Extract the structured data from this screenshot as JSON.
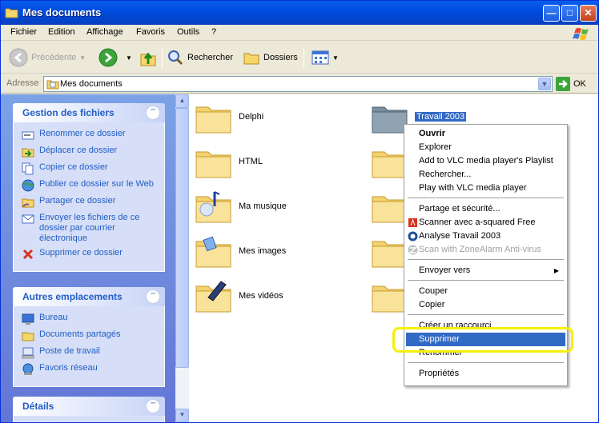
{
  "window": {
    "title": "Mes documents"
  },
  "menu": [
    "Fichier",
    "Edition",
    "Affichage",
    "Favoris",
    "Outils",
    "?"
  ],
  "toolbar": {
    "back_label": "Précédente",
    "search_label": "Rechercher",
    "folders_label": "Dossiers"
  },
  "address": {
    "label": "Adresse",
    "value": "Mes documents",
    "go_label": "OK"
  },
  "file_tasks": {
    "title": "Gestion des fichiers",
    "items": [
      "Renommer ce dossier",
      "Déplacer ce dossier",
      "Copier ce dossier",
      "Publier ce dossier sur le Web",
      "Partager ce dossier",
      "Envoyer les fichiers de ce dossier par courrier électronique",
      "Supprimer ce dossier"
    ]
  },
  "other_places": {
    "title": "Autres emplacements",
    "items": [
      "Bureau",
      "Documents partagés",
      "Poste de travail",
      "Favoris réseau"
    ]
  },
  "details": {
    "title": "Détails"
  },
  "folders": [
    {
      "name": "Delphi"
    },
    {
      "name": "HTML"
    },
    {
      "name": "Ma musique"
    },
    {
      "name": "Mes images"
    },
    {
      "name": "Mes vidéos"
    },
    {
      "name": "Travail 2003"
    }
  ],
  "context_menu": [
    "Ouvrir",
    "Explorer",
    "Add to VLC media player's Playlist",
    "Rechercher...",
    "Play with VLC media player",
    "Partage et sécurité...",
    "Scanner avec a-squared Free",
    "Analyse Travail 2003",
    "Scan with ZoneAlarm Anti-virus",
    "Envoyer vers",
    "Couper",
    "Copier",
    "Créer un raccourci",
    "Supprimer",
    "Renommer",
    "Propriétés"
  ],
  "colors": {
    "highlight": "#316ac5",
    "annotation": "#f5f008",
    "task_link": "#215dc6"
  }
}
